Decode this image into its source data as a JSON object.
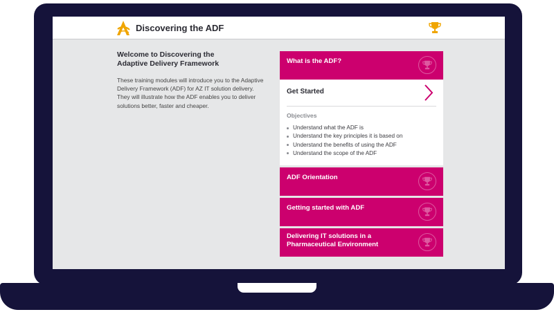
{
  "header": {
    "title": "Discovering the ADF",
    "logo_icon": "az-logo-icon",
    "trophy_icon": "trophy-icon",
    "logo_color": "#f0a500"
  },
  "intro": {
    "heading_line1": "Welcome to Discovering the",
    "heading_line2": "Adaptive Delivery Framework",
    "body": "These training modules will introduce you to the Adaptive Delivery Framework (ADF) for AZ IT solution delivery. They will illustrate how the ADF enables you to deliver solutions better, faster and cheaper."
  },
  "modules": {
    "accent_color": "#cc006e",
    "items": [
      {
        "label": "What is the ADF?"
      },
      {
        "label": "ADF Orientation"
      },
      {
        "label": "Getting started with ADF"
      },
      {
        "label": "Delivering IT solutions in a Pharmaceutical Environment"
      }
    ],
    "expanded": {
      "action_label": "Get Started",
      "objectives_title": "Objectives",
      "objectives": [
        "Understand what the ADF is",
        "Understand the key principles it is based on",
        "Understand the benefits of using the ADF",
        "Understand the scope of the ADF"
      ]
    }
  }
}
